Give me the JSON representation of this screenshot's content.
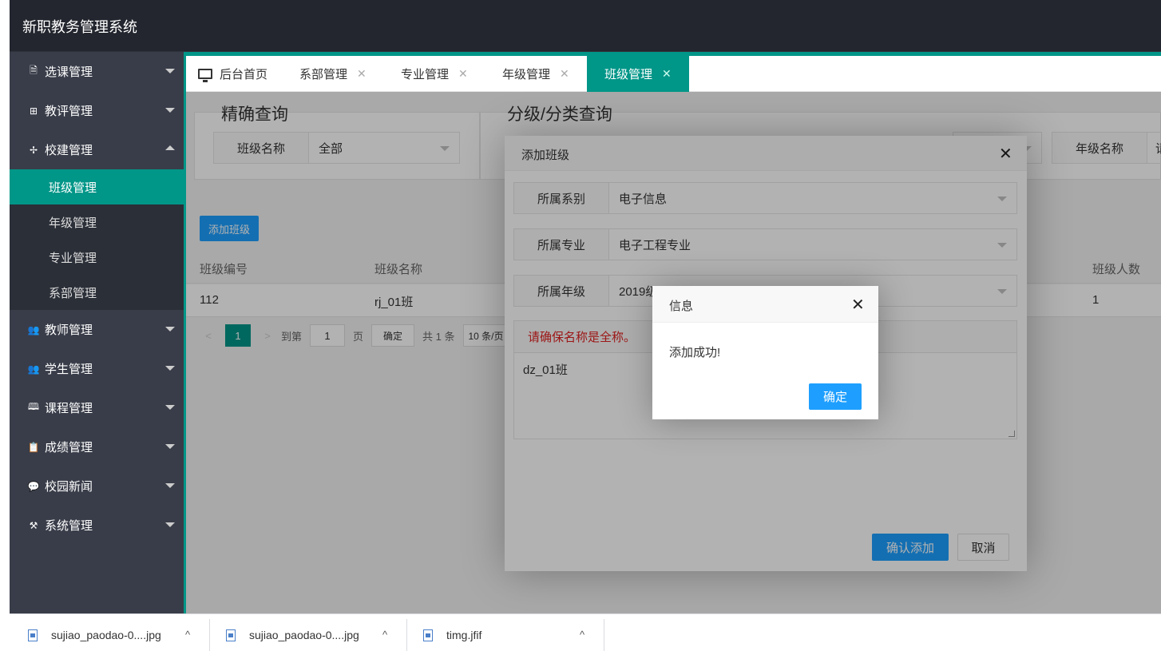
{
  "app": {
    "title": "新职教务管理系统"
  },
  "sidebar": {
    "items": [
      {
        "label": "选课管理",
        "icon": "document-icon",
        "glyph": "🗎"
      },
      {
        "label": "教评管理",
        "icon": "grid-icon",
        "glyph": "⊞"
      },
      {
        "label": "校建管理",
        "icon": "tree-icon",
        "glyph": "✢"
      },
      {
        "label": "教师管理",
        "icon": "users-icon",
        "glyph": "👥"
      },
      {
        "label": "学生管理",
        "icon": "users-icon",
        "glyph": "👥"
      },
      {
        "label": "课程管理",
        "icon": "book-icon",
        "glyph": "🕮"
      },
      {
        "label": "成绩管理",
        "icon": "clipboard-icon",
        "glyph": "📋"
      },
      {
        "label": "校园新闻",
        "icon": "chat-icon",
        "glyph": "💬"
      },
      {
        "label": "系统管理",
        "icon": "tools-icon",
        "glyph": "⚒"
      }
    ],
    "submenu": [
      "班级管理",
      "年级管理",
      "专业管理",
      "系部管理"
    ]
  },
  "tabs": [
    {
      "label": "后台首页"
    },
    {
      "label": "系部管理"
    },
    {
      "label": "专业管理"
    },
    {
      "label": "年级管理"
    },
    {
      "label": "班级管理"
    }
  ],
  "tab_close_glyph": "✕",
  "search": {
    "exact_title": "精确查询",
    "category_title": "分级/分类查询",
    "class_name_label": "班级名称",
    "class_name_value": "全部",
    "grade_name_label": "年级名称",
    "grade_name_partial": "请"
  },
  "list": {
    "add_button": "添加班级",
    "columns": [
      "班级编号",
      "班级名称",
      "班级人数"
    ],
    "rows": [
      {
        "id": "112",
        "name": "rj_01班",
        "count": "1"
      }
    ]
  },
  "pager": {
    "prev": "<",
    "current": "1",
    "next": ">",
    "goto_label": "到第",
    "goto_value": "1",
    "page_unit": "页",
    "confirm": "确定",
    "total": "共 1 条",
    "page_size": "10 条/页"
  },
  "add_dialog": {
    "title": "添加班级",
    "close": "✕",
    "department_label": "所属系别",
    "department_value": "电子信息",
    "major_label": "所属专业",
    "major_value": "电子工程专业",
    "grade_label": "所属年级",
    "grade_value": "2019级",
    "name_note": "请确保名称是全称。",
    "name_value": "dz_01班",
    "confirm_button": "确认添加",
    "cancel_button": "取消"
  },
  "message": {
    "title": "信息",
    "close": "✕",
    "body": "添加成功!",
    "ok": "确定"
  },
  "downloads": [
    {
      "name": "sujiao_paodao-0....jpg"
    },
    {
      "name": "sujiao_paodao-0....jpg"
    },
    {
      "name": "timg.jfif"
    }
  ],
  "download_chevron": "^",
  "colors": {
    "accent": "#009688",
    "primary": "#1e9fff",
    "sidebar": "#393d49",
    "header": "#23262e",
    "warning_text": "#e02020"
  }
}
